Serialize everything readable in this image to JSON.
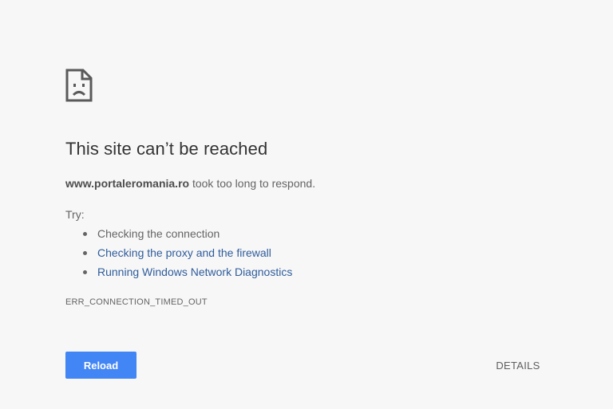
{
  "icon": "sad-page-icon",
  "title": "This site can’t be reached",
  "summary": {
    "host": "www.portaleromania.ro",
    "message": " took too long to respond."
  },
  "try_label": "Try:",
  "suggestions": [
    {
      "text": "Checking the connection",
      "is_link": false
    },
    {
      "text": "Checking the proxy and the firewall",
      "is_link": true
    },
    {
      "text": "Running Windows Network Diagnostics",
      "is_link": true
    }
  ],
  "error_code": "ERR_CONNECTION_TIMED_OUT",
  "buttons": {
    "reload": "Reload",
    "details": "DETAILS"
  },
  "colors": {
    "background": "#f7f7f7",
    "primary_button": "#4285f4",
    "link": "#2f5d9c",
    "title": "#333333",
    "text": "#646464"
  }
}
